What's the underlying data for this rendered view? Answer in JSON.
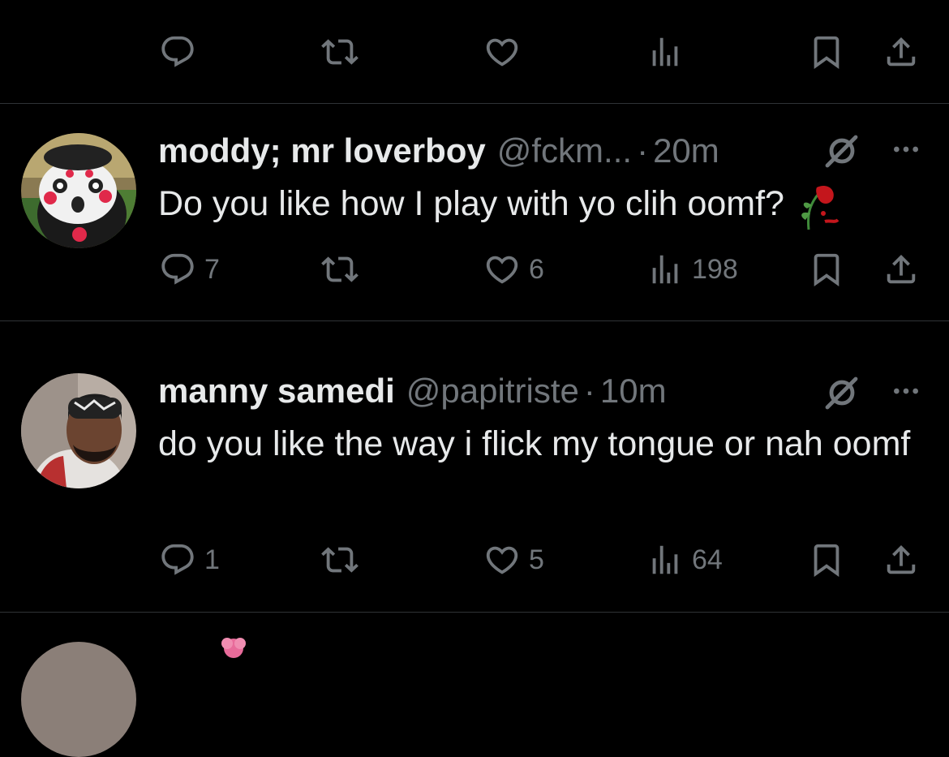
{
  "tweets": [
    {
      "name": "moddy; mr loverboy",
      "handle": "@fckm...",
      "separator": "·",
      "time": "20m",
      "text": "Do you like how I play with yo clih oomf?",
      "emoji": "wilted-rose",
      "reply_count": "7",
      "retweet_count": "",
      "like_count": "6",
      "view_count": "198"
    },
    {
      "name": "manny samedi",
      "handle": "@papitriste",
      "separator": "·",
      "time": "10m",
      "text": "do you like the way i flick my tongue or nah oomf",
      "reply_count": "1",
      "retweet_count": "",
      "like_count": "5",
      "view_count": "64"
    }
  ],
  "colors": {
    "background": "#000000",
    "text_primary": "#e7e9ea",
    "text_secondary": "#71767b",
    "divider": "#2f3336"
  },
  "icons": [
    "reply-icon",
    "retweet-icon",
    "like-icon",
    "views-icon",
    "bookmark-icon",
    "share-icon",
    "grok-icon",
    "more-icon"
  ]
}
